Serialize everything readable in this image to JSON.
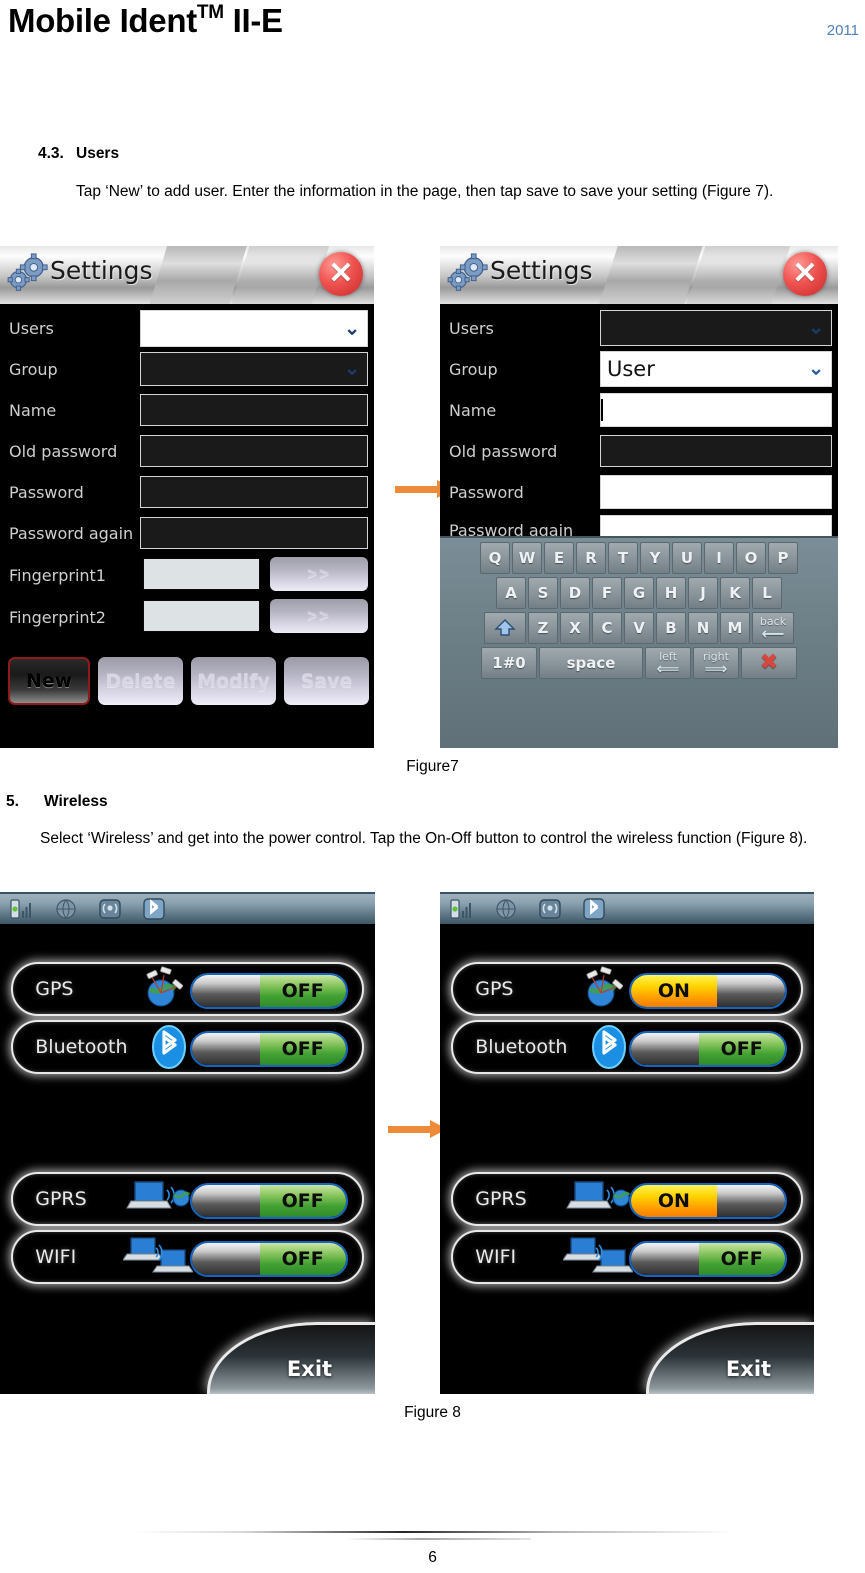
{
  "document": {
    "title_main": "Mobile Ident",
    "title_tm": "TM",
    "title_suffix": " II-E",
    "year": "2011",
    "page_number": "6"
  },
  "sections": [
    {
      "number": "4.3.",
      "heading": "Users",
      "body": "Tap ‘New’ to add user. Enter the information in the page, then tap save to save your setting (Figure 7).",
      "figure_caption": "Figure7"
    },
    {
      "number": "5.",
      "heading": "Wireless",
      "body": "Select ‘Wireless’ and get into the power control. Tap the On-Off button to control the wireless function (Figure 8).",
      "figure_caption": "Figure 8"
    }
  ],
  "settings_left": {
    "window_title": "Settings",
    "icon": "gears-icon",
    "close_icon": "close-icon",
    "fields": [
      {
        "label": "Users",
        "value": "",
        "type": "dropdown",
        "state": "white"
      },
      {
        "label": "Group",
        "value": "",
        "type": "dropdown",
        "state": "dark"
      },
      {
        "label": "Name",
        "value": "",
        "type": "text",
        "state": "dark"
      },
      {
        "label": "Old password",
        "value": "",
        "type": "text",
        "state": "dark"
      },
      {
        "label": "Password",
        "value": "",
        "type": "text",
        "state": "dark"
      },
      {
        "label": "Password again",
        "value": "",
        "type": "text",
        "state": "dark"
      }
    ],
    "fingerprints": [
      {
        "label": "Fingerprint1",
        "value": "",
        "button": ">>"
      },
      {
        "label": "Fingerprint2",
        "value": "",
        "button": ">>"
      }
    ],
    "actions": [
      {
        "label": "New",
        "primary": true
      },
      {
        "label": "Delete",
        "primary": false
      },
      {
        "label": "Modify",
        "primary": false
      },
      {
        "label": "Save",
        "primary": false
      }
    ]
  },
  "settings_right": {
    "window_title": "Settings",
    "icon": "gears-icon",
    "close_icon": "close-icon",
    "fields": [
      {
        "label": "Users",
        "value": "",
        "type": "dropdown",
        "state": "dark"
      },
      {
        "label": "Group",
        "value": "User",
        "type": "dropdown",
        "state": "white"
      },
      {
        "label": "Name",
        "value": "",
        "type": "text",
        "state": "white",
        "focused": true
      },
      {
        "label": "Old password",
        "value": "",
        "type": "text",
        "state": "dark"
      },
      {
        "label": "Password",
        "value": "",
        "type": "text",
        "state": "white"
      },
      {
        "label": "Password again",
        "value": "",
        "type": "text",
        "state": "white"
      }
    ],
    "keyboard": {
      "row1": [
        "Q",
        "W",
        "E",
        "R",
        "T",
        "Y",
        "U",
        "I",
        "O",
        "P"
      ],
      "row2": [
        "A",
        "S",
        "D",
        "F",
        "G",
        "H",
        "J",
        "K",
        "L"
      ],
      "row3_shift": "shift-icon",
      "row3": [
        "Z",
        "X",
        "C",
        "V",
        "B",
        "N",
        "M"
      ],
      "row3_back": "back",
      "row4_num": "1#0",
      "row4_space": "space",
      "row4_left": "left",
      "row4_right": "right",
      "row4_del": "close-icon"
    }
  },
  "wireless_left": {
    "status_icons": [
      "signal-battery-icon",
      "globe-icon",
      "antenna-icon",
      "bluetooth-icon"
    ],
    "rows": [
      {
        "name": "GPS",
        "icon": "gps-globe-icon",
        "state": "OFF"
      },
      {
        "name": "Bluetooth",
        "icon": "bluetooth-icon",
        "state": "OFF"
      },
      {
        "name": "GPRS",
        "icon": "gprs-laptop-icon",
        "state": "OFF"
      },
      {
        "name": "WIFI",
        "icon": "wifi-laptops-icon",
        "state": "OFF"
      }
    ],
    "exit_label": "Exit"
  },
  "wireless_right": {
    "status_icons": [
      "signal-battery-icon",
      "globe-icon",
      "antenna-icon",
      "bluetooth-icon"
    ],
    "rows": [
      {
        "name": "GPS",
        "icon": "gps-globe-icon",
        "state": "ON"
      },
      {
        "name": "Bluetooth",
        "icon": "bluetooth-icon",
        "state": "OFF"
      },
      {
        "name": "GPRS",
        "icon": "gprs-laptop-icon",
        "state": "ON"
      },
      {
        "name": "WIFI",
        "icon": "wifi-laptops-icon",
        "state": "OFF"
      }
    ],
    "exit_label": "Exit"
  },
  "colors": {
    "year_blue": "#4f81bd",
    "arrow_orange": "#ED8B38",
    "toggle_off_green": "#43a233",
    "toggle_on_yellow": "#ffd400",
    "primary_btn_border": "#8f1a1a"
  }
}
